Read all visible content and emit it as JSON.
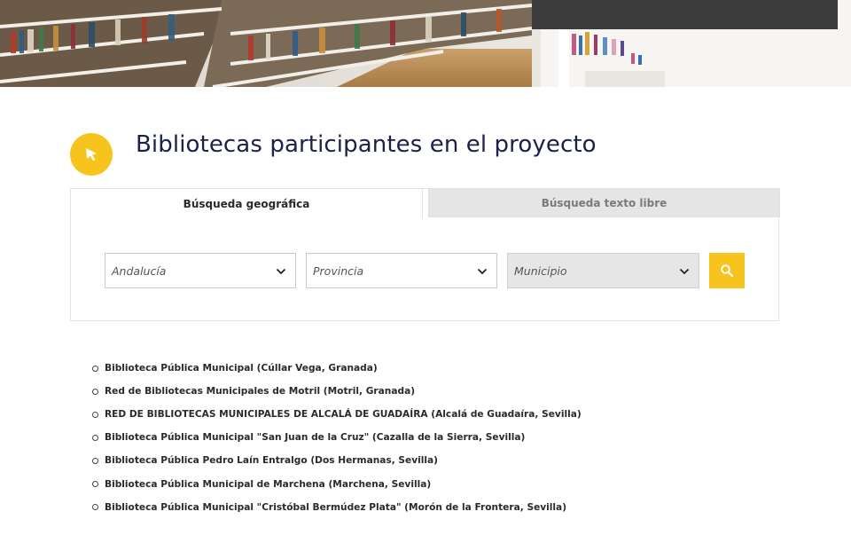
{
  "hero": {
    "image": "library-bookshelves-banner"
  },
  "header": {
    "icon": "cursor-pointer-icon",
    "title": "Bibliotecas participantes en el proyecto",
    "accent_color": "#f7c41d",
    "title_color": "#1b2147"
  },
  "search": {
    "tabs": [
      {
        "label": "Búsqueda geográfica",
        "active": true
      },
      {
        "label": "Búsqueda texto libre",
        "active": false
      }
    ],
    "region": {
      "value": "Andalucía"
    },
    "province": {
      "value": "Provincia"
    },
    "municipality": {
      "value": "Municipio",
      "disabled": true
    },
    "button_icon": "search-icon"
  },
  "libraries": [
    "Biblioteca Pública Municipal (Cúllar Vega, Granada)",
    "Red de Bibliotecas Municipales de Motril (Motril, Granada)",
    "RED DE BIBLIOTECAS MUNICIPALES DE ALCALÁ DE GUADAÍRA (Alcalá de Guadaíra, Sevilla)",
    "Biblioteca Pública Municipal \"San Juan de la Cruz\" (Cazalla de la Sierra, Sevilla)",
    "Biblioteca Pública Pedro Laín Entralgo (Dos Hermanas, Sevilla)",
    "Biblioteca Pública Municipal de Marchena (Marchena, Sevilla)",
    "Biblioteca Pública Municipal \"Cristóbal Bermúdez Plata\" (Morón de la Frontera, Sevilla)"
  ]
}
